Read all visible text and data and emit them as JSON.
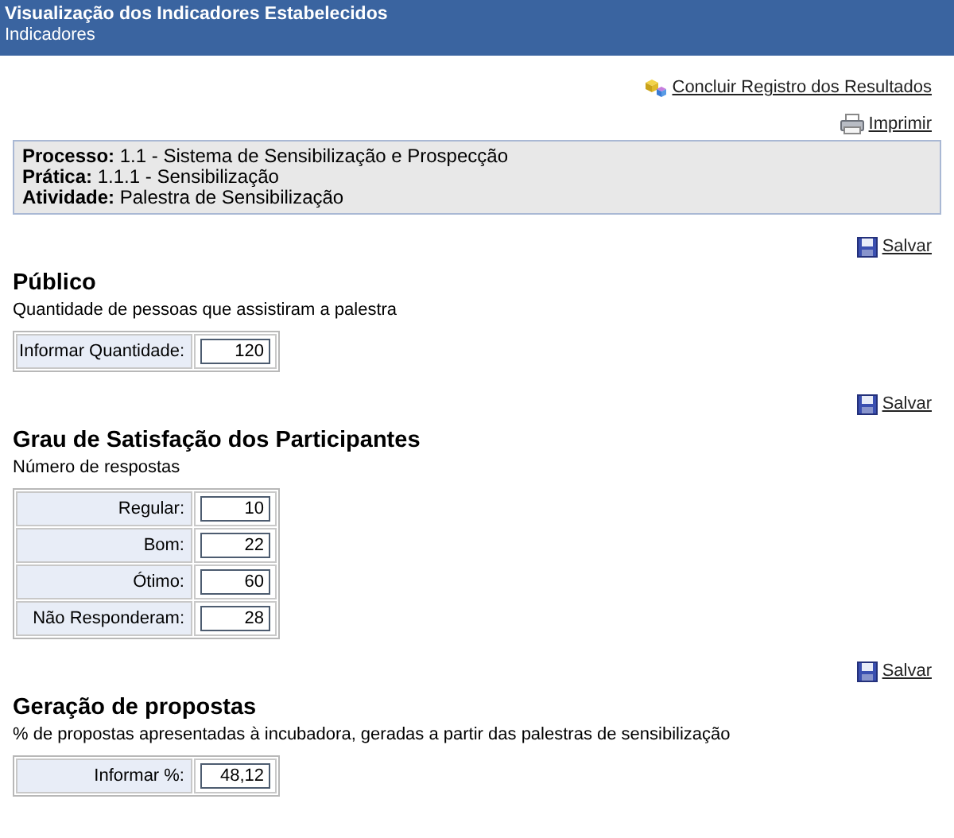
{
  "header": {
    "title": "Visualização dos Indicadores Estabelecidos",
    "subtitle": "Indicadores"
  },
  "actions": [
    {
      "kind": "finish",
      "label": "Concluir Registro dos Resultados"
    },
    {
      "kind": "print",
      "label": "Imprimir"
    }
  ],
  "info": [
    "**Processo:** 1.1 - Sistema de Sensibilização e Prospecção",
    "**Prática:** 1.1.1 - Sensibilização",
    "**Atividade:** Palestra de Sensibilização"
  ],
  "sections": [
    {
      "save": "Salvar",
      "title": "Público",
      "description": "Quantidade de pessoas que assistiram a palestra",
      "fields": [
        {
          "label": "Informar Quantidade:",
          "value": "120"
        }
      ]
    },
    {
      "save": "Salvar",
      "title": "Grau de Satisfação dos Participantes",
      "description": "Número de respostas",
      "fields": [
        {
          "label": "Regular:",
          "value": "10"
        },
        {
          "label": "Bom:",
          "value": "22"
        },
        {
          "label": "Ótimo:",
          "value": "60"
        },
        {
          "label": "Não Responderam:",
          "value": "28"
        }
      ]
    },
    {
      "save": "Salvar",
      "title": "Geração de propostas",
      "description": "% de propostas apresentadas à incubadora, geradas a partir das palestras de sensibilização",
      "fields": [
        {
          "label": "Informar %:",
          "value": "48,12"
        }
      ]
    }
  ]
}
